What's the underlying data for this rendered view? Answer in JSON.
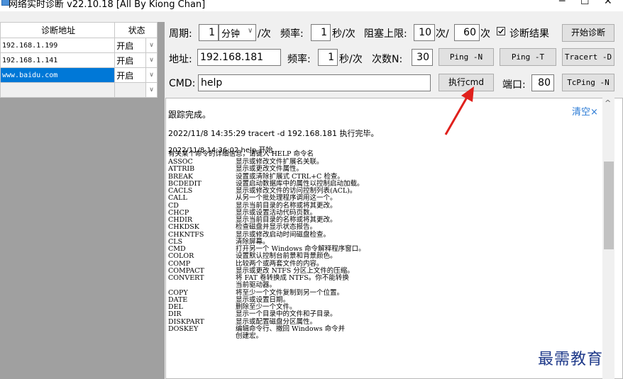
{
  "window": {
    "title": "网络实时诊断 v22.10.18 [All By Kiong Chan]",
    "minimize_glyph": "─",
    "maximize_glyph": "☐",
    "close_glyph": "✕"
  },
  "left_table": {
    "headers": [
      "诊断地址",
      "状态"
    ],
    "rows": [
      {
        "address": "192.168.1.199",
        "status": "开启"
      },
      {
        "address": "192.168.1.141",
        "status": "开启"
      },
      {
        "address": "www.baidu.com",
        "status": "开启"
      }
    ],
    "dropdown_glyph": "∨"
  },
  "row1": {
    "period_label": "周期:",
    "period_value": "1",
    "period_unit": "分钟",
    "period_unit_glyph": "∨",
    "per_time": "/次",
    "freq_label": "频率:",
    "freq_value": "1",
    "freq_unit": "秒/次",
    "block_label": "阻塞上限:",
    "block_value1": "10",
    "block_sep": "次/",
    "block_value2": "60",
    "block_unit": "次",
    "diag_result_label": "诊断结果",
    "diag_checked": true,
    "start_button": "开始诊断"
  },
  "row2": {
    "address_label": "地址:",
    "address_value": "192.168.181",
    "freq_label": "频率:",
    "freq_value": "1",
    "freq_unit": "秒/次",
    "count_label": "次数N:",
    "count_value": "30",
    "ping_n": "Ping -N",
    "ping_t": "Ping -T",
    "tracert": "Tracert -D"
  },
  "row3": {
    "cmd_label": "CMD:",
    "cmd_value": "help",
    "exec_button": "执行cmd",
    "port_label": "端口:",
    "port_value": "80",
    "tcping": "TcPing -N"
  },
  "output": {
    "clear_label": "清空×",
    "lines": [
      "跟踪完成。",
      "2022/11/8 14:35:29      tracert -d 192.168.181  执行完毕。",
      "2022/11/8 14:36:02      help    开始..."
    ],
    "help_intro": "有关某个命令的详细信息，请键入 HELP 命令名",
    "commands": [
      {
        "cmd": "ASSOC",
        "desc": "显示或修改文件扩展名关联。"
      },
      {
        "cmd": "ATTRIB",
        "desc": "显示或更改文件属性。"
      },
      {
        "cmd": "BREAK",
        "desc": "设置或清除扩展式 CTRL+C 检查。"
      },
      {
        "cmd": "BCDEDIT",
        "desc": "设置启动数据库中的属性以控制启动加载。"
      },
      {
        "cmd": "CACLS",
        "desc": "显示或修改文件的访问控制列表(ACL)。"
      },
      {
        "cmd": "CALL",
        "desc": "从另一个批处理程序调用这一个。"
      },
      {
        "cmd": "CD",
        "desc": "显示当前目录的名称或将其更改。"
      },
      {
        "cmd": "CHCP",
        "desc": "显示或设置活动代码页数。"
      },
      {
        "cmd": "CHDIR",
        "desc": "显示当前目录的名称或将其更改。"
      },
      {
        "cmd": "CHKDSK",
        "desc": "检查磁盘并显示状态报告。"
      },
      {
        "cmd": "CHKNTFS",
        "desc": "显示或修改启动时间磁盘检查。"
      },
      {
        "cmd": "CLS",
        "desc": "清除屏幕。"
      },
      {
        "cmd": "CMD",
        "desc": "打开另一个 Windows 命令解释程序窗口。"
      },
      {
        "cmd": "COLOR",
        "desc": "设置默认控制台前景和背景颜色。"
      },
      {
        "cmd": "COMP",
        "desc": "比较两个或两套文件的内容。"
      },
      {
        "cmd": "COMPACT",
        "desc": "显示或更改 NTFS 分区上文件的压缩。"
      },
      {
        "cmd": "CONVERT",
        "desc": "将 FAT 卷转换成 NTFS。你不能转换"
      },
      {
        "cmd": "",
        "desc": "当前驱动器。"
      },
      {
        "cmd": "COPY",
        "desc": "将至少一个文件复制到另一个位置。"
      },
      {
        "cmd": "DATE",
        "desc": "显示或设置日期。"
      },
      {
        "cmd": "DEL",
        "desc": "删除至少一个文件。"
      },
      {
        "cmd": "DIR",
        "desc": "显示一个目录中的文件和子目录。"
      },
      {
        "cmd": "DISKPART",
        "desc": "显示或配置磁盘分区属性。"
      },
      {
        "cmd": "DOSKEY",
        "desc": "编辑命令行、撤回 Windows 命令并"
      },
      {
        "cmd": "",
        "desc": "创建宏。"
      }
    ],
    "scroll_up_glyph": "^"
  },
  "watermark": "最需教育",
  "colors": {
    "selection": "#0078d7",
    "arrow": "#e0201c",
    "link": "#2a7ad5"
  }
}
